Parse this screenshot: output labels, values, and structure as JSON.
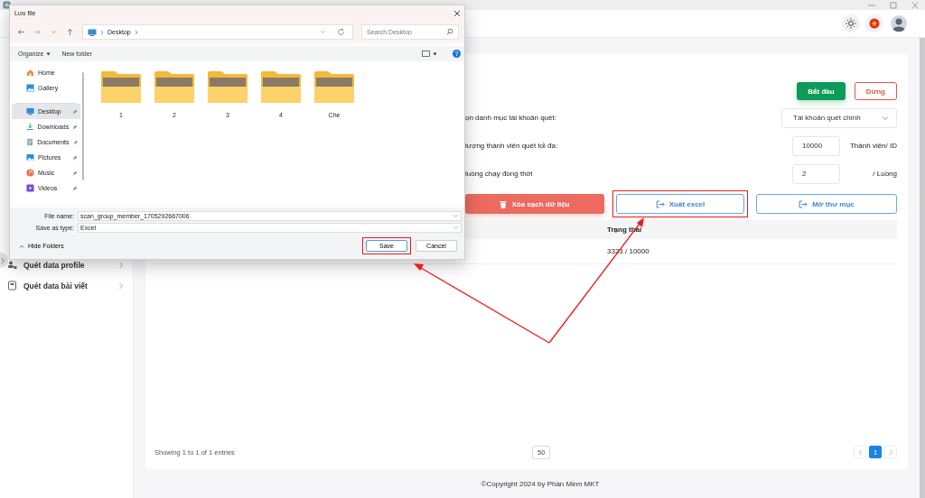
{
  "sidebar": {
    "items": [
      {
        "label": "Quét data profile"
      },
      {
        "label": "Quét data bài viết"
      }
    ]
  },
  "main": {
    "actions": [
      {
        "label": "Bắt đầu",
        "kind": "primary"
      },
      {
        "label": "Dừng",
        "kind": "outline"
      }
    ],
    "form": [
      {
        "label": "ọn danh mục tài khoản quét:",
        "kind": "select",
        "value": "Tài khoản quét chính"
      },
      {
        "label": "lượng thành viên quét tối đa:",
        "kind": "number",
        "value": "10000",
        "unit": "Thành viên/ ID"
      },
      {
        "label": "luồng chạy đồng thời",
        "kind": "number",
        "value": "2",
        "unit": "/ Luồng"
      }
    ],
    "tools": [
      {
        "label": "Xóa sạch dữ liệu",
        "kind": "danger",
        "highlighted": false
      },
      {
        "label": "Xuất excel",
        "kind": "outline",
        "highlighted": true
      },
      {
        "label": "Mở thư mục",
        "kind": "outline",
        "highlighted": false
      }
    ],
    "table": {
      "columns": [
        "Trạng thái"
      ],
      "rows": [
        [
          "3323 / 10000"
        ]
      ]
    },
    "footer": {
      "info": "Showing 1 to 1 of 1 entries",
      "page_size": "50",
      "pages": [
        {
          "label": "1",
          "selected": true
        }
      ]
    }
  },
  "copyright": "©Copyright 2024 by Phần Mềm MKT",
  "dialog": {
    "title": "Lưu file",
    "path": [
      "Desktop"
    ],
    "search": {
      "placeholder": "Search Desktop"
    },
    "toolbar": [
      "Organize",
      "New folder"
    ],
    "nav": [
      {
        "label": "Home",
        "selected": false,
        "pinned": false
      },
      {
        "label": "Gallery",
        "selected": false,
        "pinned": false
      },
      {
        "label": "Desktop",
        "selected": true,
        "pinned": true
      },
      {
        "label": "Downloads",
        "selected": false,
        "pinned": true
      },
      {
        "label": "Documents",
        "selected": false,
        "pinned": true
      },
      {
        "label": "Pictures",
        "selected": false,
        "pinned": true
      },
      {
        "label": "Music",
        "selected": false,
        "pinned": true
      },
      {
        "label": "Videos",
        "selected": false,
        "pinned": true
      }
    ],
    "folders": [
      "1",
      "2",
      "3",
      "4",
      "Che"
    ],
    "file_name": {
      "label": "File name:",
      "value": "scan_group_member_1705292667006"
    },
    "file_type": {
      "label": "Save as type:",
      "value": "Excel"
    },
    "hide_folders": "Hide Folders",
    "buttons": [
      {
        "label": "Save",
        "kind": "default",
        "highlighted": true
      },
      {
        "label": "Cancel",
        "kind": "normal",
        "highlighted": false
      }
    ]
  }
}
